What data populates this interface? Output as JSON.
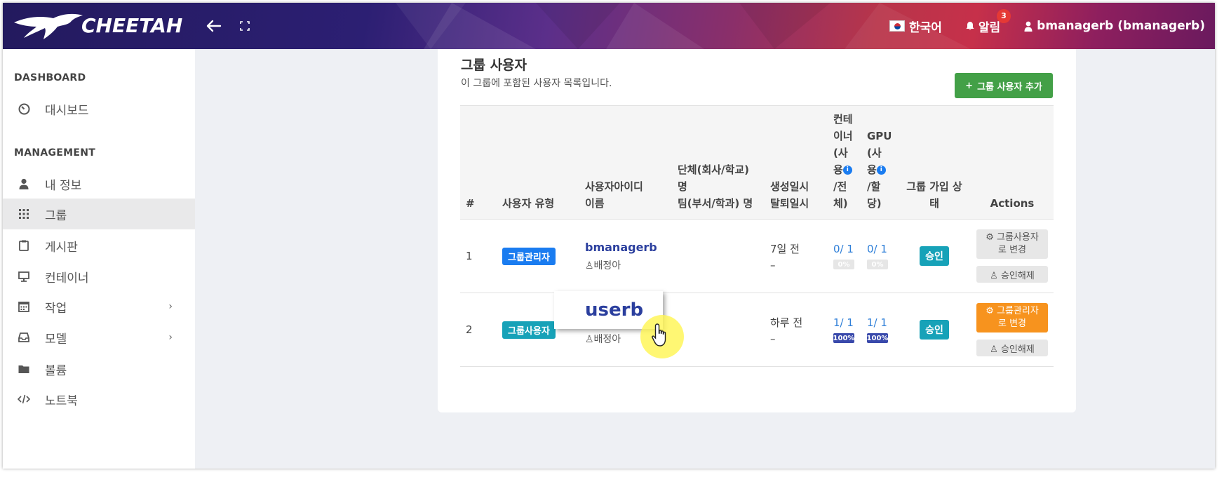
{
  "header": {
    "brand": "CHEETAH",
    "language": "한국어",
    "alerts_label": "알림",
    "alerts_count": "3",
    "user": "bmanagerb (bmanagerb)"
  },
  "sidebar": {
    "sections": [
      {
        "title": "DASHBOARD",
        "items": [
          {
            "label": "대시보드",
            "icon": "dashboard-gauge-icon"
          }
        ]
      },
      {
        "title": "MANAGEMENT",
        "items": [
          {
            "label": "내 정보",
            "icon": "user-icon"
          },
          {
            "label": "그룹",
            "icon": "grid-icon",
            "active": true
          },
          {
            "label": "게시판",
            "icon": "clipboard-icon"
          },
          {
            "label": "컨테이너",
            "icon": "monitor-icon"
          },
          {
            "label": "작업",
            "icon": "calendar-icon",
            "has_children": true
          },
          {
            "label": "모델",
            "icon": "inbox-icon",
            "has_children": true
          },
          {
            "label": "볼륨",
            "icon": "folder-icon"
          },
          {
            "label": "노트북",
            "icon": "code-icon"
          }
        ]
      }
    ]
  },
  "card": {
    "title": "그룹 사용자",
    "subtitle": "이 그룹에 포함된 사용자 목록입니다.",
    "add_button": "그룹 사용자 추가"
  },
  "table": {
    "headers": {
      "no": "#",
      "type": "사용자 유형",
      "id_line1": "사용자아이디",
      "id_line2": "이름",
      "org_line1": "단체(회사/학교)",
      "org_line2": "명",
      "org_line3": "팀(부서/학과) 명",
      "date_line1": "생성일시",
      "date_line2": "탈퇴일시",
      "container": [
        "컨테",
        "이너",
        "(사",
        "용",
        "/전",
        "체)"
      ],
      "gpu": [
        "GPU",
        "(사",
        "용",
        "/할",
        "당)"
      ],
      "status_line1": "그룹 가입 상",
      "status_line2": "태",
      "actions": "Actions"
    },
    "rows": [
      {
        "no": "1",
        "type": "그룹관리자",
        "user_id": "bmanagerb",
        "name": "♙배정아",
        "created": "7일 전",
        "withdrawn": "–",
        "container_usage": "0/ 1",
        "container_pct": "0%",
        "container_frac": 0,
        "gpu_usage": "0/ 1",
        "gpu_pct": "0%",
        "gpu_frac": 0,
        "status": "승인",
        "action_primary_line1": "⚙ 그룹사용자",
        "action_primary_line2": "로 변경",
        "action_secondary": "♙ 승인해제"
      },
      {
        "no": "2",
        "type": "그룹사용자",
        "user_id": "userb",
        "name": "♙배정아",
        "created": "하루 전",
        "withdrawn": "–",
        "container_usage": "1/ 1",
        "container_pct": "100%",
        "container_frac": 1,
        "gpu_usage": "1/ 1",
        "gpu_pct": "100%",
        "gpu_frac": 1,
        "status": "승인",
        "action_primary_line1": "⚙ 그룹관리자",
        "action_primary_line2": "로 변경",
        "action_secondary": "♙ 승인해제"
      }
    ]
  },
  "zoom_callout": "userb",
  "colors": {
    "add_button": "#43a047",
    "admin_badge": "#1a7cf0",
    "user_badge": "#17a2b8",
    "status_badge": "#17a2b8",
    "change_to_admin": "#f7931e",
    "alert_badge": "#e53935"
  }
}
